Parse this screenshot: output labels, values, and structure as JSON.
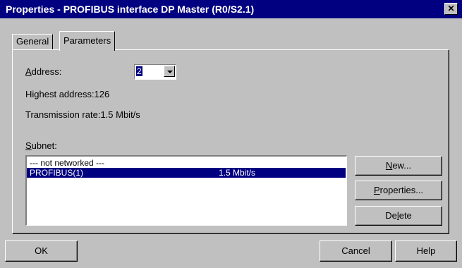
{
  "window": {
    "title": "Properties - PROFIBUS interface  DP Master (R0/S2.1)",
    "close_glyph": "✕"
  },
  "tabs": [
    {
      "label": "General"
    },
    {
      "label": "Parameters"
    }
  ],
  "parameters": {
    "address_label_first": "A",
    "address_label_rest": "ddress:",
    "address_value": "2",
    "highest_address": "Highest address:126",
    "transmission_rate": "Transmission rate:1.5 Mbit/s",
    "subnet_label_first": "S",
    "subnet_label_rest": "ubnet:"
  },
  "subnet_list": [
    {
      "name": "--- not networked ---",
      "rate": ""
    },
    {
      "name": "PROFIBUS(1)",
      "rate": "1.5 Mbit/s"
    }
  ],
  "buttons": {
    "new_mnemonic": "N",
    "new_rest": "ew...",
    "properties_mnemonic": "P",
    "properties_rest": "roperties...",
    "delete_pre": "De",
    "delete_mnemonic": "l",
    "delete_post": "ete",
    "ok": "OK",
    "cancel": "Cancel",
    "help": "Help"
  }
}
